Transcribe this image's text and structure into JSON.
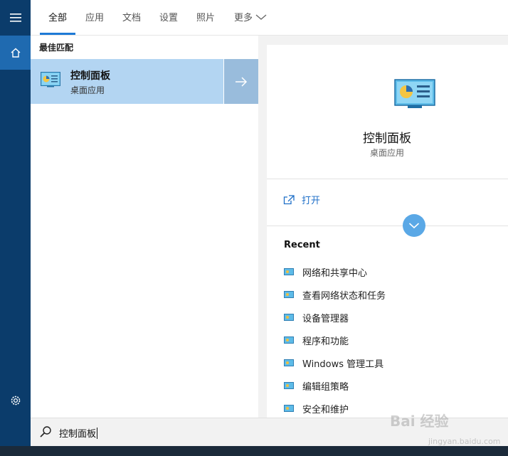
{
  "tabs": [
    {
      "label": "全部"
    },
    {
      "label": "应用"
    },
    {
      "label": "文档"
    },
    {
      "label": "设置"
    },
    {
      "label": "照片"
    },
    {
      "label": "更多"
    }
  ],
  "results": {
    "section_title": "最佳匹配",
    "best_match": {
      "name": "控制面板",
      "subtitle": "桌面应用"
    }
  },
  "preview": {
    "title": "控制面板",
    "subtitle": "桌面应用",
    "open_label": "打开",
    "recent_title": "Recent",
    "recent_items": [
      "网络和共享中心",
      "查看网络状态和任务",
      "设备管理器",
      "程序和功能",
      "Windows 管理工具",
      "编辑组策略",
      "安全和维护"
    ]
  },
  "search": {
    "query": "控制面板"
  },
  "watermark": {
    "logo": "Bai 经验",
    "sub": "jingyan.baidu.com"
  },
  "colors": {
    "rail": "#0b3c6b",
    "rail_active": "#1f6ab0",
    "accent": "#1e7ad6",
    "selected": "#b3d5f2"
  }
}
